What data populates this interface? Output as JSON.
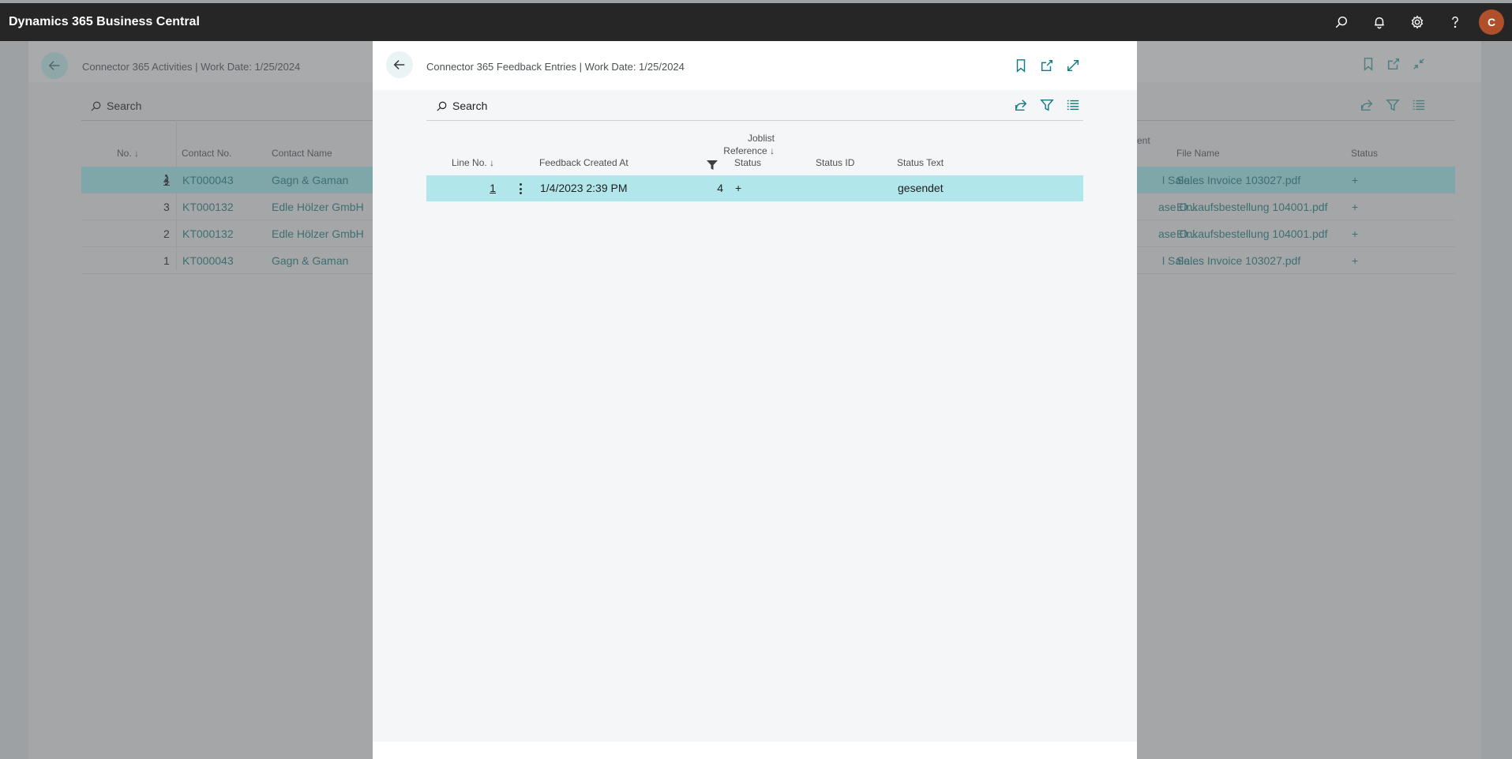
{
  "app": {
    "title": "Dynamics 365 Business Central",
    "avatar_initial": "C"
  },
  "topbar_icons": [
    "search-icon",
    "bell-icon",
    "gear-icon",
    "help-icon"
  ],
  "background_page": {
    "title": "Connector 365 Activities | Work Date: 1/25/2024",
    "search_placeholder": "Search",
    "columns": {
      "no": "No.",
      "no_sort": "↓",
      "contact_no": "Contact No.",
      "contact_name": "Contact Name",
      "document_partial": "ent",
      "file_name": "File Name",
      "status": "Status"
    },
    "rows": [
      {
        "no": "4",
        "contact_no": "KT000043",
        "contact_name": "Gagn & Gaman",
        "document": "l Sale...",
        "file_name": "Sales Invoice 103027.pdf",
        "status": "+"
      },
      {
        "no": "3",
        "contact_no": "KT000132",
        "contact_name": "Edle Hölzer GmbH",
        "document": "ase O...",
        "file_name": "Einkaufsbestellung 104001.pdf",
        "status": "+"
      },
      {
        "no": "2",
        "contact_no": "KT000132",
        "contact_name": "Edle Hölzer GmbH",
        "document": "ase O...",
        "file_name": "Einkaufsbestellung 104001.pdf",
        "status": "+"
      },
      {
        "no": "1",
        "contact_no": "KT000043",
        "contact_name": "Gagn & Gaman",
        "document": "l Sale...",
        "file_name": "Sales Invoice 103027.pdf",
        "status": "+"
      }
    ]
  },
  "dialog": {
    "title": "Connector 365 Feedback Entries | Work Date: 1/25/2024",
    "search_placeholder": "Search",
    "columns": {
      "line_no": "Line No.",
      "line_no_sort": "↓",
      "feedback_created_at": "Feedback Created At",
      "joblist_reference_line1": "Joblist",
      "joblist_reference_line2": "Reference",
      "joblist_sort": "↓",
      "status": "Status",
      "status_id": "Status ID",
      "status_text": "Status Text"
    },
    "rows": [
      {
        "line_no": "1",
        "feedback_created_at": "1/4/2023 2:39 PM",
        "joblist_reference": "4",
        "status": "+",
        "status_id": "",
        "status_text": "gesendet"
      }
    ]
  }
}
